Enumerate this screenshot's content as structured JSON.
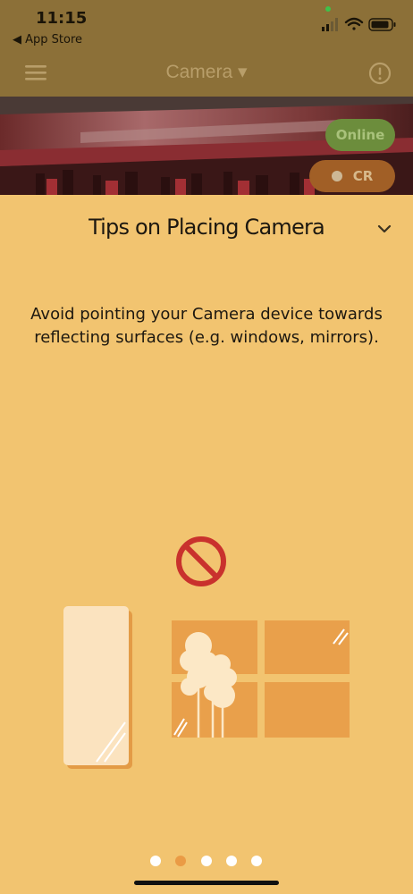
{
  "status": {
    "time": "11:15",
    "back_label": "◀ App Store"
  },
  "header": {
    "title": "Camera ▾"
  },
  "badges": {
    "online": "Online",
    "cr": "CR"
  },
  "tips": {
    "title": "Tips on Placing Camera",
    "text": "Avoid pointing your Camera device towards reflecting surfaces (e.g. windows, mirrors)."
  },
  "pager": {
    "count": 5,
    "active": 2
  },
  "colors": {
    "background": "#f2c470",
    "accent": "#ea9b45",
    "prohibited": "#c9312d",
    "online": "#6c8d3c",
    "cr": "#a15f26"
  },
  "icons": [
    "hamburger-menu-icon",
    "info-icon",
    "chevron-down-icon",
    "prohibited-icon",
    "mirror-illustration",
    "window-illustration"
  ]
}
